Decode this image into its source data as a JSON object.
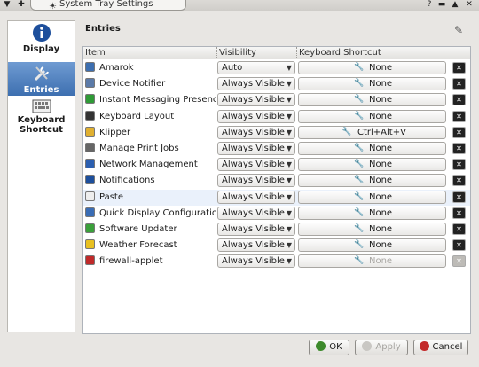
{
  "window": {
    "title": "System Tray Settings"
  },
  "sidebar": {
    "items": [
      {
        "label": "Display"
      },
      {
        "label": "Entries"
      },
      {
        "label_line1": "Keyboard",
        "label_line2": "Shortcut"
      }
    ]
  },
  "main": {
    "heading": "Entries",
    "columns": {
      "item": "Item",
      "visibility": "Visibility",
      "shortcut": "Keyboard Shortcut"
    }
  },
  "rows": [
    {
      "name": "Amarok",
      "visibility": "Auto",
      "shortcut": "None"
    },
    {
      "name": "Device Notifier",
      "visibility": "Always Visible",
      "shortcut": "None"
    },
    {
      "name": "Instant Messaging Presence",
      "visibility": "Always Visible",
      "shortcut": "None"
    },
    {
      "name": "Keyboard Layout",
      "visibility": "Always Visible",
      "shortcut": "None"
    },
    {
      "name": "Klipper",
      "visibility": "Always Visible",
      "shortcut": "Ctrl+Alt+V"
    },
    {
      "name": "Manage Print Jobs",
      "visibility": "Always Visible",
      "shortcut": "None"
    },
    {
      "name": "Network Management",
      "visibility": "Always Visible",
      "shortcut": "None"
    },
    {
      "name": "Notifications",
      "visibility": "Always Visible",
      "shortcut": "None"
    },
    {
      "name": "Paste",
      "visibility": "Always Visible",
      "shortcut": "None"
    },
    {
      "name": "Quick Display Configuration",
      "visibility": "Always Visible",
      "shortcut": "None"
    },
    {
      "name": "Software Updater",
      "visibility": "Always Visible",
      "shortcut": "None"
    },
    {
      "name": "Weather Forecast",
      "visibility": "Always Visible",
      "shortcut": "None"
    },
    {
      "name": "firewall-applet",
      "visibility": "Always Visible",
      "shortcut": "None"
    }
  ],
  "buttons": {
    "ok": "OK",
    "apply": "Apply",
    "cancel": "Cancel"
  }
}
